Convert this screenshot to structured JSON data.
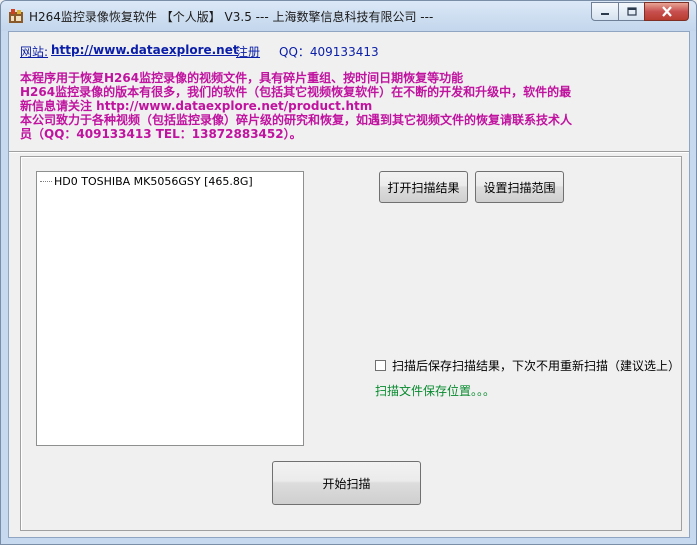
{
  "window": {
    "title": "H264监控录像恢复软件 【个人版】 V3.5 --- 上海数擎信息科技有限公司 ---"
  },
  "header": {
    "site_label": "网站:",
    "site_url": "http://www.dataexplore.net",
    "register": "注册",
    "qq": "QQ：409133413"
  },
  "intro": {
    "lines": [
      "本程序用于恢复H264监控录像的视频文件，具有碎片重组、按时间日期恢复等功能",
      "H264监控录像的版本有很多，我们的软件（包括其它视频恢复软件）在不断的开发和升级中，软件的最",
      "新信息请关注 http://www.dataexplore.net/product.htm",
      "本公司致力于各种视频（包括监控录像）碎片级的研究和恢复，如遇到其它视频文件的恢复请联系技术人",
      "员（QQ：409133413  TEL：13872883452）。"
    ]
  },
  "tree": {
    "items": [
      {
        "label": "HD0  TOSHIBA MK5056GSY  [465.8G]"
      }
    ]
  },
  "buttons": {
    "open_results": "打开扫描结果",
    "set_range": "设置扫描范围",
    "start_scan": "开始扫描"
  },
  "options": {
    "save_results_label": "扫描后保存扫描结果，下次不用重新扫描（建议选上）",
    "save_location": "扫描文件保存位置。。。"
  },
  "colors": {
    "intro_text": "#c0139f",
    "link": "#0a1ea8",
    "save_location": "#078a2e"
  }
}
